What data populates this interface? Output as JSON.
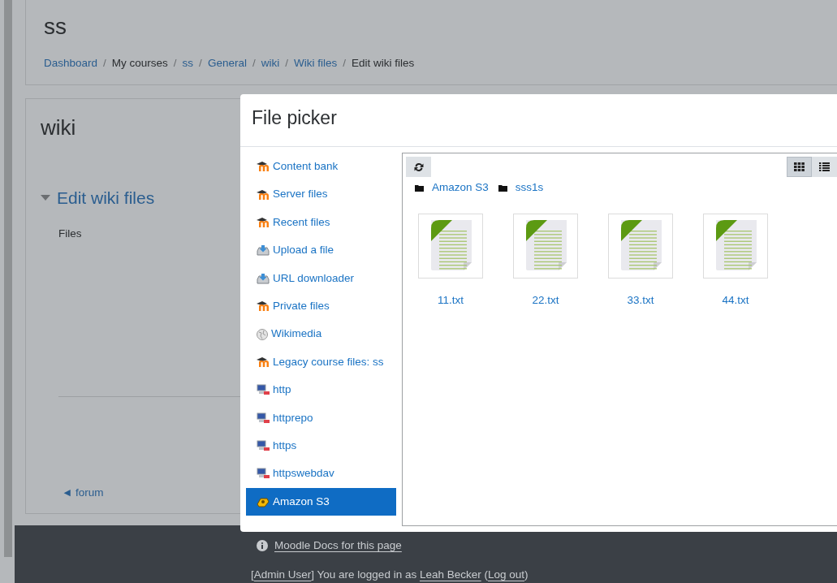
{
  "page": {
    "title": "ss",
    "separator": "/",
    "breadcrumb": [
      {
        "text": "Dashboard",
        "link": true
      },
      {
        "text": "My courses",
        "link": false
      },
      {
        "text": "ss",
        "link": true
      },
      {
        "text": "General",
        "link": true
      },
      {
        "text": "wiki",
        "link": true
      },
      {
        "text": "Wiki files",
        "link": true
      },
      {
        "text": "Edit wiki files",
        "link": false
      }
    ],
    "activity_title": "wiki",
    "section_title": "Edit wiki files",
    "files_label": "Files",
    "prev_link": "◄ forum"
  },
  "file_picker": {
    "title": "File picker",
    "repositories": [
      {
        "label": "Content bank",
        "kind": "moodle",
        "selected": false
      },
      {
        "label": "Server files",
        "kind": "moodle",
        "selected": false
      },
      {
        "label": "Recent files",
        "kind": "moodle",
        "selected": false
      },
      {
        "label": "Upload a file",
        "kind": "upload",
        "selected": false
      },
      {
        "label": "URL downloader",
        "kind": "upload",
        "selected": false
      },
      {
        "label": "Private files",
        "kind": "moodle",
        "selected": false
      },
      {
        "label": "Wikimedia",
        "kind": "wiki",
        "selected": false
      },
      {
        "label": "Legacy course files: ss",
        "kind": "moodle",
        "selected": false
      },
      {
        "label": "http",
        "kind": "computer",
        "selected": false
      },
      {
        "label": "httprepo",
        "kind": "computer",
        "selected": false
      },
      {
        "label": "https",
        "kind": "computer",
        "selected": false
      },
      {
        "label": "httpswebdav",
        "kind": "computer",
        "selected": false
      },
      {
        "label": "Amazon S3",
        "kind": "amazon",
        "selected": true
      }
    ],
    "path": [
      "Amazon S3",
      "sss1s"
    ],
    "view_modes": [
      {
        "kind": "icons",
        "selected": true
      },
      {
        "kind": "list",
        "selected": false
      }
    ],
    "files": [
      "11.txt",
      "22.txt",
      "33.txt",
      "44.txt"
    ]
  },
  "footer": {
    "docs_link": "Moodle Docs for this page",
    "login_line": [
      {
        "text": "[",
        "link": false
      },
      {
        "text": "Admin User",
        "link": true
      },
      {
        "text": "] You are logged in as ",
        "link": false
      },
      {
        "text": "Leah Becker",
        "link": true
      },
      {
        "text": " (",
        "link": false
      },
      {
        "text": "Log out",
        "link": true
      },
      {
        "text": ")",
        "link": false
      }
    ]
  }
}
